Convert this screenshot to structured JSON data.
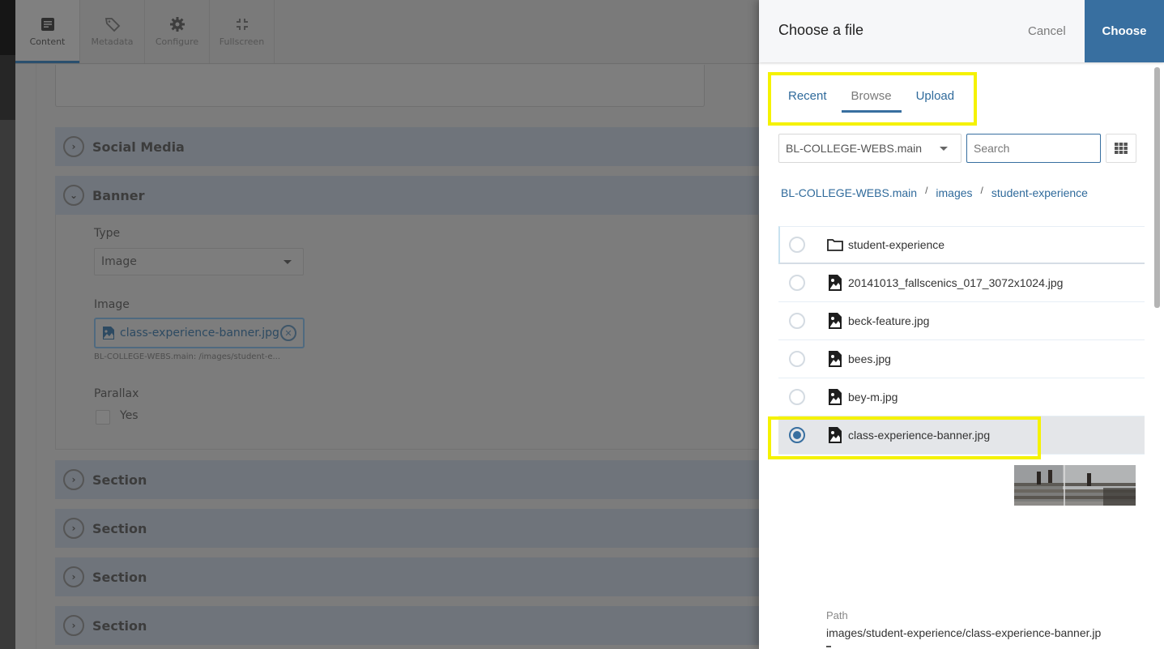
{
  "editor": {
    "toolbar": [
      {
        "label": "Content",
        "icon": "content-icon",
        "active": true
      },
      {
        "label": "Metadata",
        "icon": "tag-icon",
        "active": false
      },
      {
        "label": "Configure",
        "icon": "gear-icon",
        "active": false
      },
      {
        "label": "Fullscreen",
        "icon": "fullscreen-icon",
        "active": false
      }
    ],
    "accordions": {
      "social_media": "Social Media",
      "banner": "Banner",
      "sections": [
        "Section",
        "Section",
        "Section",
        "Section"
      ]
    },
    "banner": {
      "type_label": "Type",
      "type_value": "Image",
      "image_label": "Image",
      "image_value": "class-experience-banner.jpg",
      "image_path": "BL-COLLEGE-WEBS.main: /images/student-e...",
      "parallax_label": "Parallax",
      "parallax_option": "Yes",
      "parallax_checked": false
    }
  },
  "drawer": {
    "title": "Choose a file",
    "cancel_label": "Cancel",
    "choose_label": "Choose",
    "tabs": [
      {
        "label": "Recent",
        "active": false
      },
      {
        "label": "Browse",
        "active": true
      },
      {
        "label": "Upload",
        "active": false
      }
    ],
    "site_select": "BL-COLLEGE-WEBS.main",
    "search_placeholder": "Search",
    "search_value": "",
    "breadcrumb": [
      "BL-COLLEGE-WEBS.main",
      "images",
      "student-experience"
    ],
    "breadcrumb_sep": "/",
    "items": [
      {
        "name": "student-experience",
        "type": "folder",
        "selected": false
      },
      {
        "name": "20141013_fallscenics_017_3072x1024.jpg",
        "type": "image",
        "selected": false
      },
      {
        "name": "beck-feature.jpg",
        "type": "image",
        "selected": false
      },
      {
        "name": "bees.jpg",
        "type": "image",
        "selected": false
      },
      {
        "name": "bey-m.jpg",
        "type": "image",
        "selected": false
      },
      {
        "name": "class-experience-banner.jpg",
        "type": "image",
        "selected": true
      }
    ],
    "path_label": "Path",
    "path_value": "images/student-experience/class-experience-banner.jp",
    "colors": {
      "accent": "#386fa0",
      "highlight": "#f5f200",
      "selected_row": "#e4e6e9"
    }
  }
}
